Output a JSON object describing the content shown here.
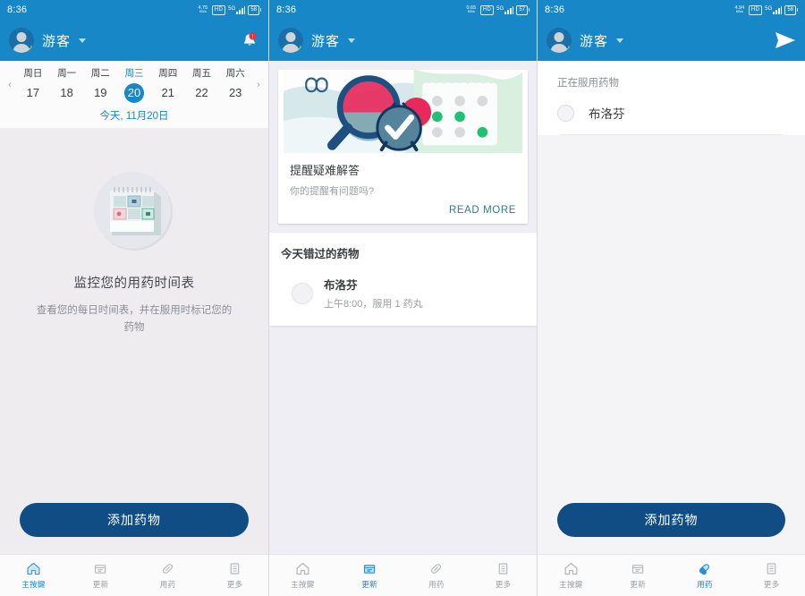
{
  "statusbar": {
    "time": "8:36",
    "speed_value_p1": "4.75",
    "speed_value_p2": "0.65",
    "speed_value_p3": "4.94",
    "speed_unit": "KB/s",
    "hd_label": "HD",
    "network_label": "5G",
    "battery_p1": "58",
    "battery_p2": "57",
    "battery_p3": "58"
  },
  "appbar": {
    "profile_name": "游客",
    "bell_icon": "notification-bell-icon",
    "send_icon": "send-icon",
    "caret_icon": "chevron-down-icon"
  },
  "panel1": {
    "calendar": {
      "prev_arrow": "‹",
      "next_arrow": "›",
      "days": [
        {
          "dow": "周日",
          "num": "17",
          "selected": false
        },
        {
          "dow": "周一",
          "num": "18",
          "selected": false
        },
        {
          "dow": "周二",
          "num": "19",
          "selected": false
        },
        {
          "dow": "周三",
          "num": "20",
          "selected": true
        },
        {
          "dow": "周四",
          "num": "21",
          "selected": false
        },
        {
          "dow": "周五",
          "num": "22",
          "selected": false
        },
        {
          "dow": "周六",
          "num": "23",
          "selected": false
        }
      ],
      "today_label": "今天, 11月20日"
    },
    "empty": {
      "illustration": "calendar-illustration",
      "title": "监控您的用药时间表",
      "subtitle": "查看您的每日时间表，并在服用时标记您的药物"
    },
    "cta_label": "添加药物",
    "nav": [
      {
        "label": "主按鍵",
        "icon": "home-icon",
        "active": true
      },
      {
        "label": "更新",
        "icon": "news-icon",
        "active": false
      },
      {
        "label": "用药",
        "icon": "pill-icon",
        "active": false
      },
      {
        "label": "更多",
        "icon": "more-list-icon",
        "active": false
      }
    ]
  },
  "panel2": {
    "card": {
      "illustration": "magnifier-clock-calendar-illustration",
      "title": "提醒疑难解答",
      "subtitle": "你的提醒有问题吗?",
      "read_more": "READ MORE"
    },
    "missed": {
      "title": "今天错过的药物",
      "items": [
        {
          "name": "布洛芬",
          "dose": "上午8:00，服用 1 药丸"
        }
      ]
    },
    "nav": [
      {
        "label": "主按鍵",
        "icon": "home-icon",
        "active": false
      },
      {
        "label": "更新",
        "icon": "news-icon",
        "active": true
      },
      {
        "label": "用药",
        "icon": "pill-icon",
        "active": false
      },
      {
        "label": "更多",
        "icon": "more-list-icon",
        "active": false
      }
    ]
  },
  "panel3": {
    "list_title": "正在服用药物",
    "items": [
      {
        "name": "布洛芬"
      }
    ],
    "cta_label": "添加药物",
    "nav": [
      {
        "label": "主按鍵",
        "icon": "home-icon",
        "active": false
      },
      {
        "label": "更新",
        "icon": "news-icon",
        "active": false
      },
      {
        "label": "用药",
        "icon": "pill-icon",
        "active": true
      },
      {
        "label": "更多",
        "icon": "more-list-icon",
        "active": false
      }
    ]
  },
  "colors": {
    "appbar_blue": "#1787c8",
    "cta_navy": "#0f4d84",
    "accent_blue": "#1787c8",
    "read_more_teal": "#2f7c92"
  }
}
